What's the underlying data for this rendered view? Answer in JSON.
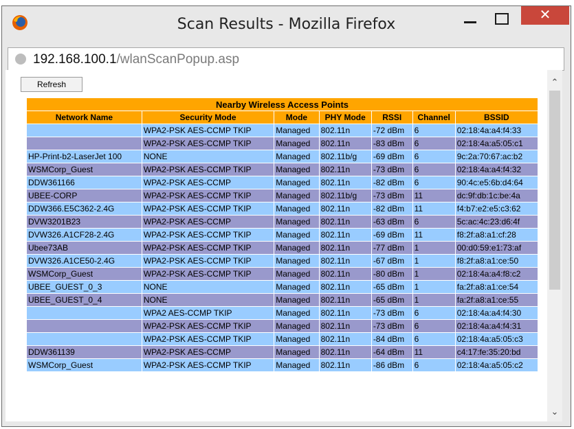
{
  "window": {
    "title": "Scan Results - Mozilla Firefox",
    "close_glyph": "✕"
  },
  "urlbar": {
    "host": "192.168.100.1",
    "path": "/wlanScanPopup.asp"
  },
  "toolbar": {
    "refresh_label": "Refresh"
  },
  "table": {
    "title": "Nearby Wireless Access Points",
    "columns": [
      "Network Name",
      "Security Mode",
      "Mode",
      "PHY Mode",
      "RSSI",
      "Channel",
      "BSSID"
    ],
    "rows": [
      [
        "",
        "WPA2-PSK AES-CCMP TKIP",
        "Managed",
        "802.11n",
        "-72 dBm",
        "6",
        "02:18:4a:a4:f4:33"
      ],
      [
        "",
        "WPA2-PSK AES-CCMP TKIP",
        "Managed",
        "802.11n",
        "-83 dBm",
        "6",
        "02:18:4a:a5:05:c1"
      ],
      [
        "HP-Print-b2-LaserJet 100",
        "NONE",
        "Managed",
        "802.11b/g",
        "-69 dBm",
        "6",
        "9c:2a:70:67:ac:b2"
      ],
      [
        "WSMCorp_Guest",
        "WPA2-PSK AES-CCMP TKIP",
        "Managed",
        "802.11n",
        "-73 dBm",
        "6",
        "02:18:4a:a4:f4:32"
      ],
      [
        "DDW361166",
        "WPA2-PSK AES-CCMP",
        "Managed",
        "802.11n",
        "-82 dBm",
        "6",
        "90:4c:e5:6b:d4:64"
      ],
      [
        "UBEE-CORP",
        "WPA2-PSK AES-CCMP TKIP",
        "Managed",
        "802.11b/g",
        "-73 dBm",
        "11",
        "dc:9f:db:1c:be:4a"
      ],
      [
        "DDW366.E5C362-2.4G",
        "WPA2-PSK AES-CCMP TKIP",
        "Managed",
        "802.11n",
        "-82 dBm",
        "11",
        "f4:b7:e2:e5:c3:62"
      ],
      [
        "DVW3201B23",
        "WPA2-PSK AES-CCMP",
        "Managed",
        "802.11n",
        "-63 dBm",
        "6",
        "5c:ac:4c:23:d6:4f"
      ],
      [
        "DVW326.A1CF28-2.4G",
        "WPA2-PSK AES-CCMP TKIP",
        "Managed",
        "802.11n",
        "-69 dBm",
        "11",
        "f8:2f:a8:a1:cf:28"
      ],
      [
        "Ubee73AB",
        "WPA2-PSK AES-CCMP TKIP",
        "Managed",
        "802.11n",
        "-77 dBm",
        "1",
        "00:d0:59:e1:73:af"
      ],
      [
        "DVW326.A1CE50-2.4G",
        "WPA2-PSK AES-CCMP TKIP",
        "Managed",
        "802.11n",
        "-67 dBm",
        "1",
        "f8:2f:a8:a1:ce:50"
      ],
      [
        "WSMCorp_Guest",
        "WPA2-PSK AES-CCMP TKIP",
        "Managed",
        "802.11n",
        "-80 dBm",
        "1",
        "02:18:4a:a4:f8:c2"
      ],
      [
        "UBEE_GUEST_0_3",
        "NONE",
        "Managed",
        "802.11n",
        "-65 dBm",
        "1",
        "fa:2f:a8:a1:ce:54"
      ],
      [
        "UBEE_GUEST_0_4",
        "NONE",
        "Managed",
        "802.11n",
        "-65 dBm",
        "1",
        "fa:2f:a8:a1:ce:55"
      ],
      [
        "",
        "WPA2 AES-CCMP TKIP",
        "Managed",
        "802.11n",
        "-73 dBm",
        "6",
        "02:18:4a:a4:f4:30"
      ],
      [
        "",
        "WPA2-PSK AES-CCMP TKIP",
        "Managed",
        "802.11n",
        "-73 dBm",
        "6",
        "02:18:4a:a4:f4:31"
      ],
      [
        "",
        "WPA2-PSK AES-CCMP TKIP",
        "Managed",
        "802.11n",
        "-84 dBm",
        "6",
        "02:18:4a:a5:05:c3"
      ],
      [
        "DDW361139",
        "WPA2-PSK AES-CCMP",
        "Managed",
        "802.11n",
        "-64 dBm",
        "11",
        "c4:17:fe:35:20:bd"
      ],
      [
        "WSMCorp_Guest",
        "WPA2-PSK AES-CCMP TKIP",
        "Managed",
        "802.11n",
        "-86 dBm",
        "6",
        "02:18:4a:a5:05:c2"
      ]
    ]
  },
  "colors": {
    "header": "#ffa500",
    "row_light": "#99ccff",
    "row_dark": "#9999cc",
    "close_button": "#c9473b"
  },
  "icons": {
    "app": "firefox-icon",
    "site": "globe-icon",
    "minimize": "minimize-icon",
    "maximize": "maximize-icon",
    "close": "close-icon",
    "scroll_up": "chevron-up-icon",
    "scroll_down": "chevron-down-icon"
  }
}
